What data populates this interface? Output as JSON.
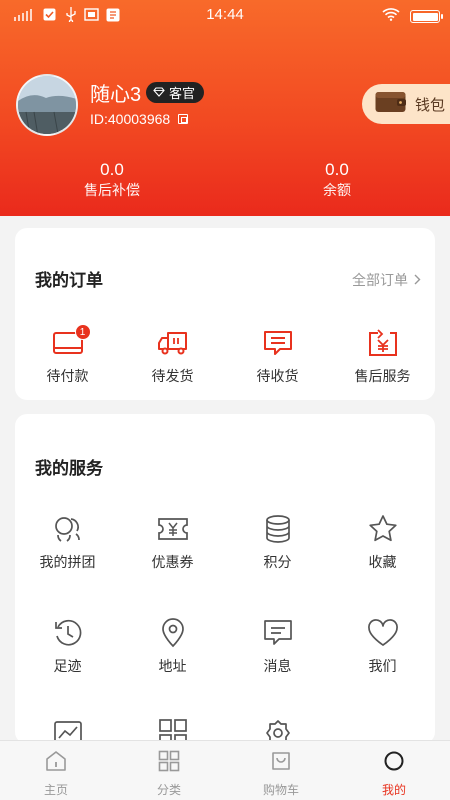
{
  "status": {
    "time": "14:44"
  },
  "profile": {
    "username": "随心3",
    "role": "客官",
    "user_id": "ID:40003968"
  },
  "wallet": {
    "label": "钱包"
  },
  "stats": [
    {
      "value": "0.0",
      "label": "售后补偿"
    },
    {
      "value": "0.0",
      "label": "余额"
    }
  ],
  "orders": {
    "title": "我的订单",
    "all_link": "全部订单",
    "items": [
      {
        "label": "待付款",
        "icon": "payment-card-icon",
        "badge": "1"
      },
      {
        "label": "待发货",
        "icon": "delivery-truck-icon"
      },
      {
        "label": "待收货",
        "icon": "receive-message-icon"
      },
      {
        "label": "售后服务",
        "icon": "refund-yen-icon"
      }
    ]
  },
  "services": {
    "title": "我的服务",
    "items": [
      {
        "label": "我的拼团",
        "icon": "group-buy-icon"
      },
      {
        "label": "优惠券",
        "icon": "coupon-icon"
      },
      {
        "label": "积分",
        "icon": "points-coins-icon"
      },
      {
        "label": "收藏",
        "icon": "star-icon"
      },
      {
        "label": "足迹",
        "icon": "history-clock-icon"
      },
      {
        "label": "地址",
        "icon": "location-pin-icon"
      },
      {
        "label": "消息",
        "icon": "message-icon"
      },
      {
        "label": "我们",
        "icon": "heart-icon"
      }
    ]
  },
  "tabbar": {
    "items": [
      {
        "label": "主页",
        "icon": "home-icon"
      },
      {
        "label": "分类",
        "icon": "category-icon"
      },
      {
        "label": "购物车",
        "icon": "cart-icon"
      },
      {
        "label": "我的",
        "icon": "profile-icon",
        "active": true
      }
    ]
  },
  "colors": {
    "brand": "#f24a22",
    "accent_red": "#e8321e",
    "icon_gray": "#555555"
  }
}
